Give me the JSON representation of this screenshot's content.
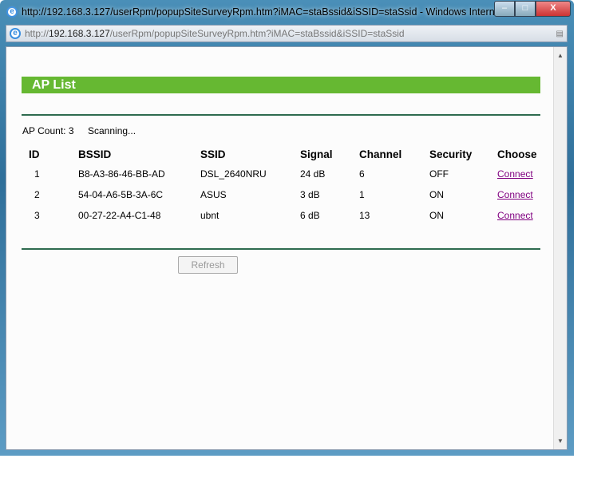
{
  "window": {
    "title": "http://192.168.3.127/userRpm/popupSiteSurveyRpm.htm?iMAC=staBssid&iSSID=staSsid - Windows Intern...",
    "address_prefix": "http://",
    "address_host": "192.168.3.127",
    "address_path": "/userRpm/popupSiteSurveyRpm.htm?iMAC=staBssid&iSSID=staSsid"
  },
  "page": {
    "header": "AP List",
    "ap_count": "AP Count: 3",
    "status": "Scanning...",
    "refresh": "Refresh",
    "columns": [
      "ID",
      "BSSID",
      "SSID",
      "Signal",
      "Channel",
      "Security",
      "Choose"
    ],
    "rows": [
      {
        "id": "1",
        "bssid": "B8-A3-86-46-BB-AD",
        "ssid": "DSL_2640NRU",
        "signal": "24 dB",
        "channel": "6",
        "security": "OFF",
        "choose": "Connect"
      },
      {
        "id": "2",
        "bssid": "54-04-A6-5B-3A-6C",
        "ssid": "ASUS",
        "signal": "3 dB",
        "channel": "1",
        "security": "ON",
        "choose": "Connect"
      },
      {
        "id": "3",
        "bssid": "00-27-22-A4-C1-48",
        "ssid": "ubnt",
        "signal": "6 dB",
        "channel": "13",
        "security": "ON",
        "choose": "Connect"
      }
    ]
  }
}
